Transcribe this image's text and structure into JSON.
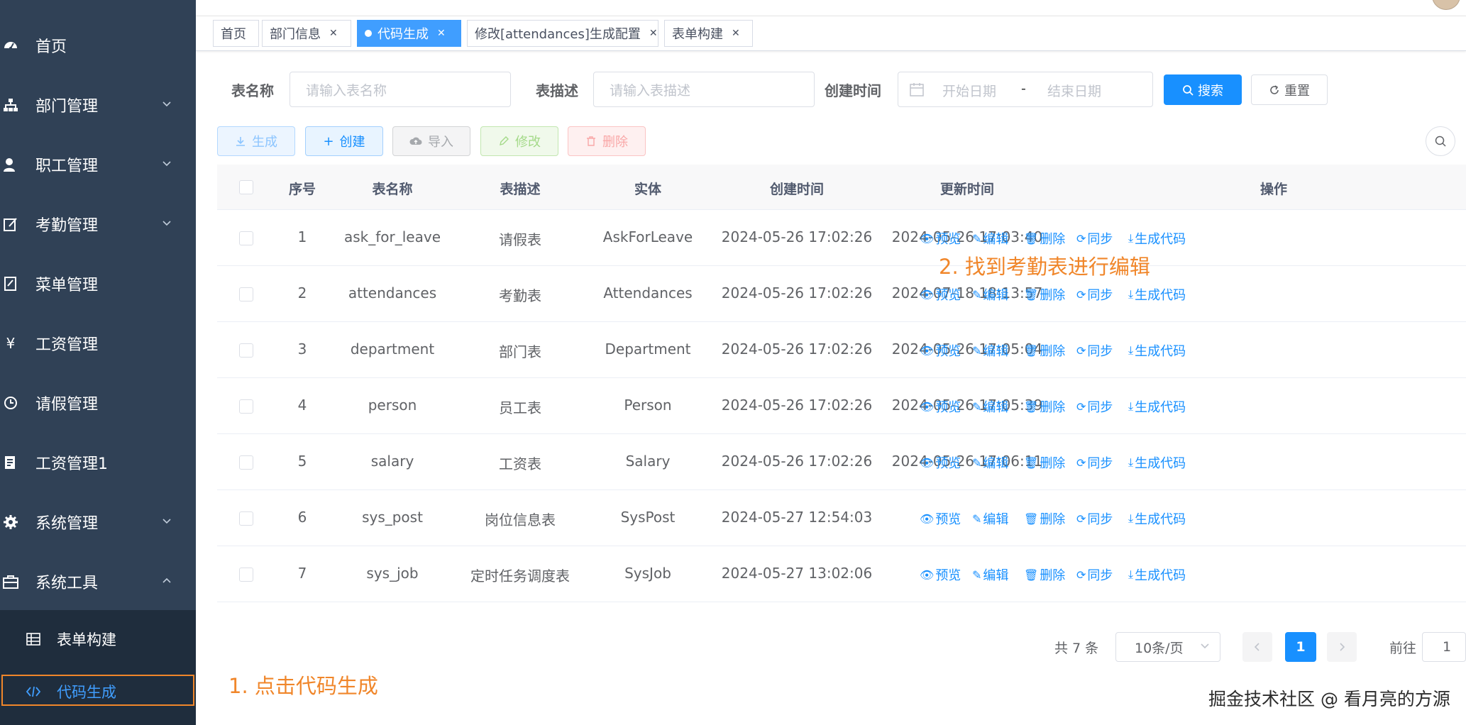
{
  "sidebar": {
    "items": [
      {
        "label": "首页",
        "icon": "dashboard-icon"
      },
      {
        "label": "部门管理",
        "icon": "tree-icon"
      },
      {
        "label": "职工管理",
        "icon": "user-icon"
      },
      {
        "label": "考勤管理",
        "icon": "edit-icon"
      },
      {
        "label": "菜单管理",
        "icon": "form-icon"
      },
      {
        "label": "工资管理",
        "icon": "yen-icon"
      },
      {
        "label": "请假管理",
        "icon": "clock-icon"
      },
      {
        "label": "工资管理1",
        "icon": "document-icon"
      },
      {
        "label": "系统管理",
        "icon": "gear-icon"
      },
      {
        "label": "系统工具",
        "icon": "toolbox-icon"
      }
    ],
    "sub_items": [
      {
        "label": "表单构建",
        "icon": "table-icon"
      },
      {
        "label": "代码生成",
        "icon": "code-icon"
      }
    ]
  },
  "tags": [
    {
      "label": "首页"
    },
    {
      "label": "部门信息"
    },
    {
      "label": "代码生成"
    },
    {
      "label": "修改[attendances]生成配置"
    },
    {
      "label": "表单构建"
    }
  ],
  "search": {
    "table_name_label": "表名称",
    "table_name_placeholder": "请输入表名称",
    "table_desc_label": "表描述",
    "table_desc_placeholder": "请输入表描述",
    "created_label": "创建时间",
    "start_placeholder": "开始日期",
    "range_separator": "-",
    "end_placeholder": "结束日期",
    "search_button": "搜索",
    "reset_button": "重置"
  },
  "toolbar": {
    "generate": "生成",
    "create": "创建",
    "import": "导入",
    "edit": "修改",
    "delete": "删除"
  },
  "table": {
    "columns": [
      "序号",
      "表名称",
      "表描述",
      "实体",
      "创建时间",
      "更新时间",
      "操作"
    ],
    "actions": [
      "预览",
      "编辑",
      "删除",
      "同步",
      "生成代码"
    ],
    "rows": [
      {
        "no": "1",
        "name": "ask_for_leave",
        "desc": "请假表",
        "entity": "AskForLeave",
        "created": "2024-05-26 17:02:26",
        "updated": "2024-05-26 17:03:40"
      },
      {
        "no": "2",
        "name": "attendances",
        "desc": "考勤表",
        "entity": "Attendances",
        "created": "2024-05-26 17:02:26",
        "updated": "2024-07-18 18:13:57"
      },
      {
        "no": "3",
        "name": "department",
        "desc": "部门表",
        "entity": "Department",
        "created": "2024-05-26 17:02:26",
        "updated": "2024-05-26 17:05:04"
      },
      {
        "no": "4",
        "name": "person",
        "desc": "员工表",
        "entity": "Person",
        "created": "2024-05-26 17:02:26",
        "updated": "2024-05-26 17:05:39"
      },
      {
        "no": "5",
        "name": "salary",
        "desc": "工资表",
        "entity": "Salary",
        "created": "2024-05-26 17:02:26",
        "updated": "2024-05-26 17:06:11"
      },
      {
        "no": "6",
        "name": "sys_post",
        "desc": "岗位信息表",
        "entity": "SysPost",
        "created": "2024-05-27 12:54:03",
        "updated": ""
      },
      {
        "no": "7",
        "name": "sys_job",
        "desc": "定时任务调度表",
        "entity": "SysJob",
        "created": "2024-05-27 13:02:06",
        "updated": ""
      }
    ]
  },
  "pagination": {
    "total": "共 7 条",
    "page_size": "10条/页",
    "current_page": "1",
    "goto_label": "前往",
    "goto_value": "1"
  },
  "annotations": {
    "step1": "1. 点击代码生成",
    "step2": "2. 找到考勤表进行编辑"
  },
  "watermark": "掘金技术社区 @ 看月亮的方源",
  "colors": {
    "sidebar_bg": "#304156",
    "submenu_bg": "#1f2d3d",
    "primary": "#1890ff",
    "annotation": "#f0862a"
  }
}
